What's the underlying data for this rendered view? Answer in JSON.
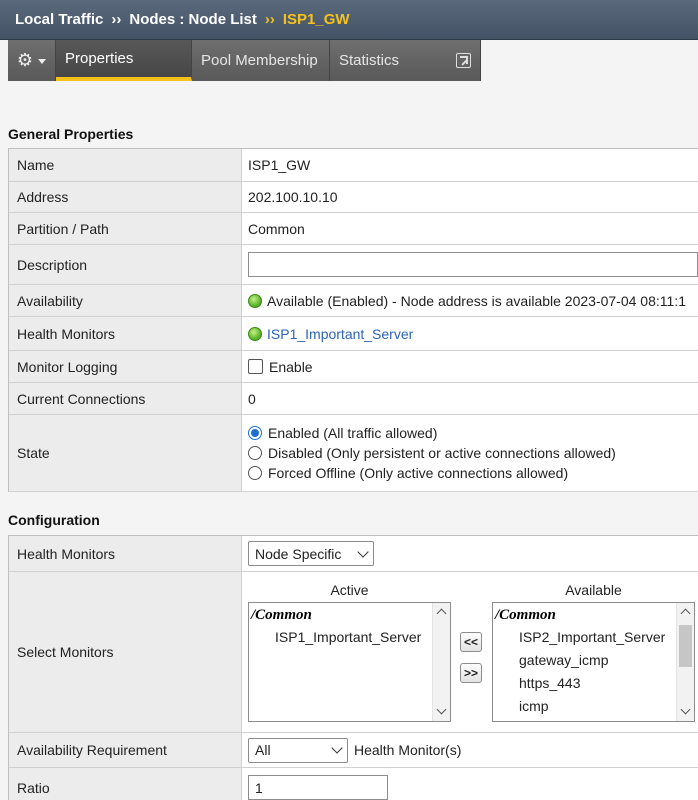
{
  "breadcrumb": {
    "section": "Local Traffic",
    "page": "Nodes : Node List",
    "current": "ISP1_GW",
    "separator": "››"
  },
  "tabs": {
    "properties": "Properties",
    "pool_membership": "Pool Membership",
    "statistics": "Statistics"
  },
  "general": {
    "title": "General Properties",
    "name_label": "Name",
    "name_value": "ISP1_GW",
    "address_label": "Address",
    "address_value": "202.100.10.10",
    "partition_label": "Partition / Path",
    "partition_value": "Common",
    "description_label": "Description",
    "description_value": "",
    "availability_label": "Availability",
    "availability_value": "Available (Enabled) - Node address is available 2023-07-04 08:11:1",
    "health_label": "Health Monitors",
    "health_value": "ISP1_Important_Server",
    "logging_label": "Monitor Logging",
    "logging_value": "Enable",
    "connections_label": "Current Connections",
    "connections_value": "0",
    "state_label": "State",
    "state_options": [
      "Enabled (All traffic allowed)",
      "Disabled (Only persistent or active connections allowed)",
      "Forced Offline (Only active connections allowed)"
    ]
  },
  "config": {
    "title": "Configuration",
    "health_label": "Health Monitors",
    "health_select": "Node Specific",
    "select_label": "Select Monitors",
    "active_header": "Active",
    "available_header": "Available",
    "group": "/Common",
    "active_items": [
      "ISP1_Important_Server"
    ],
    "available_items": [
      "ISP2_Important_Server",
      "gateway_icmp",
      "https_443",
      "icmp"
    ],
    "move_left": "<<",
    "move_right": ">>",
    "avail_req_label": "Availability Requirement",
    "avail_req_select": "All",
    "avail_req_suffix": "Health Monitor(s)",
    "ratio_label": "Ratio",
    "ratio_value": "1"
  },
  "colors": {
    "accent": "#f5c21b",
    "titlebar": "#4d5c6e",
    "link": "#2d63b8",
    "status_green": "#5cb82a"
  }
}
